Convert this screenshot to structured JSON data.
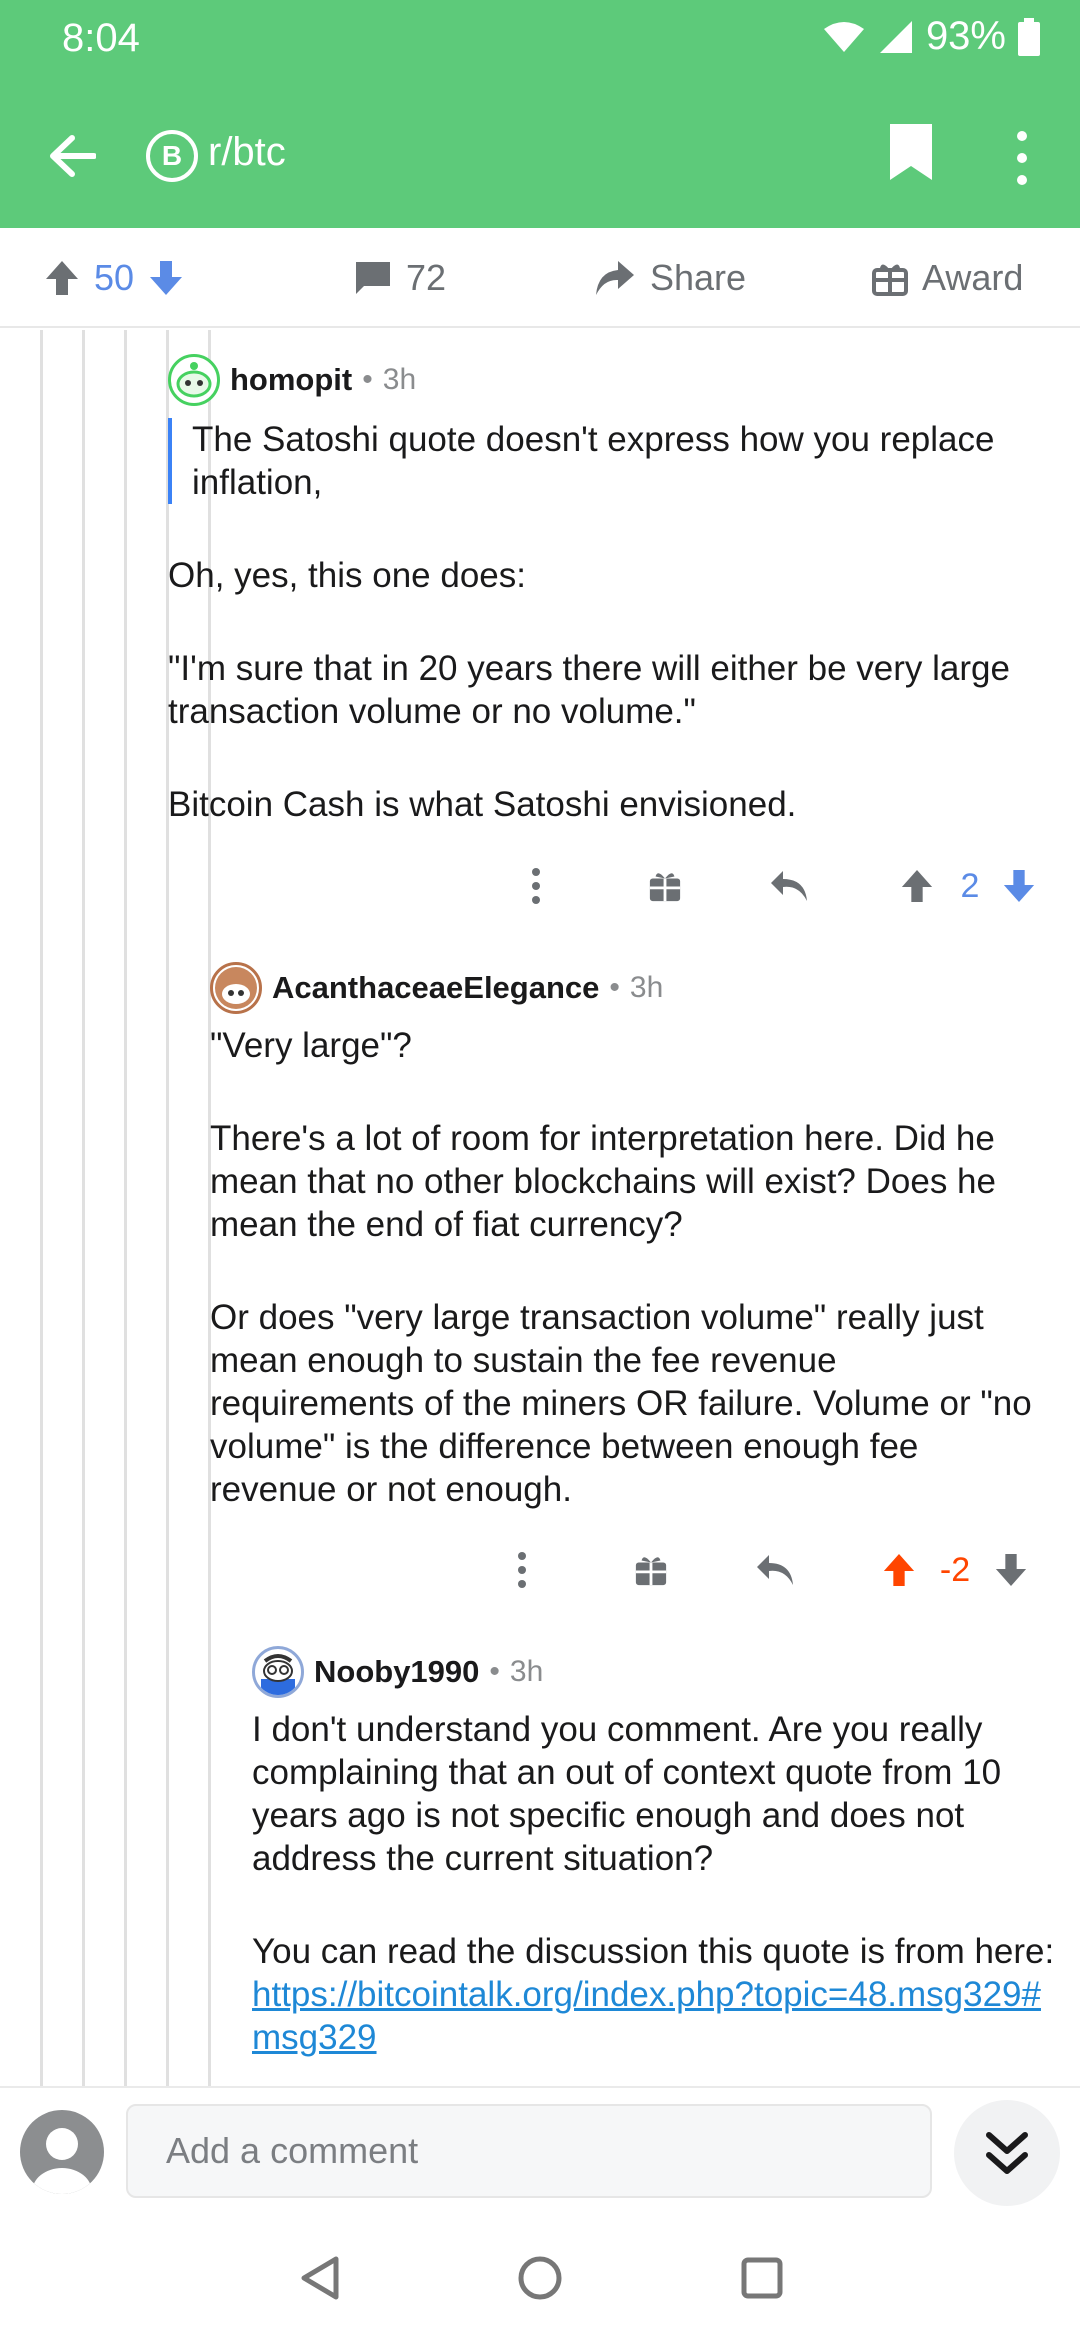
{
  "status": {
    "time": "8:04",
    "battery": "93%"
  },
  "header": {
    "subreddit": "r/btc",
    "sub_icon_letter": "B"
  },
  "post_actions": {
    "score": "50",
    "comments": "72",
    "share": "Share",
    "award": "Award"
  },
  "comments": [
    {
      "author": "homopit",
      "age": "3h",
      "quote": "The Satoshi quote doesn't express how you replace inflation,",
      "paragraphs": [
        "Oh, yes, this one does:",
        "\"I'm sure that in 20 years there will either be very large transaction volume or no volume.\"",
        "Bitcoin Cash is what Satoshi envisioned."
      ],
      "score": "2",
      "vote_state": "none"
    },
    {
      "author": "AcanthaceaeElegance",
      "age": "3h",
      "paragraphs": [
        "\"Very large\"?",
        "There's a lot of room for interpretation here. Did he mean that no other blockchains will exist? Does he mean the end of fiat currency?",
        "Or does \"very large transaction volume\" really just mean enough to sustain the fee revenue requirements of the miners OR failure. Volume or \"no volume\" is the difference between enough fee revenue or not enough."
      ],
      "score": "-2",
      "vote_state": "upvoted"
    },
    {
      "author": "Nooby1990",
      "age": "3h",
      "paragraphs": [
        "I don't understand you comment. Are you really complaining that an out of context quote from 10 years ago is not specific enough and does not address the current situation?"
      ],
      "link_prefix": "You can read the discussion this quote is from here: ",
      "link": "https://bitcointalk.org/index.php?topic=48.msg329#msg329"
    }
  ],
  "separator": "•",
  "composer": {
    "placeholder": "Add a comment"
  },
  "colors": {
    "brand": "#5dca7a",
    "vote_blue": "#5b8be6",
    "upvote_orange": "#ff4500",
    "link": "#1e88d6"
  }
}
